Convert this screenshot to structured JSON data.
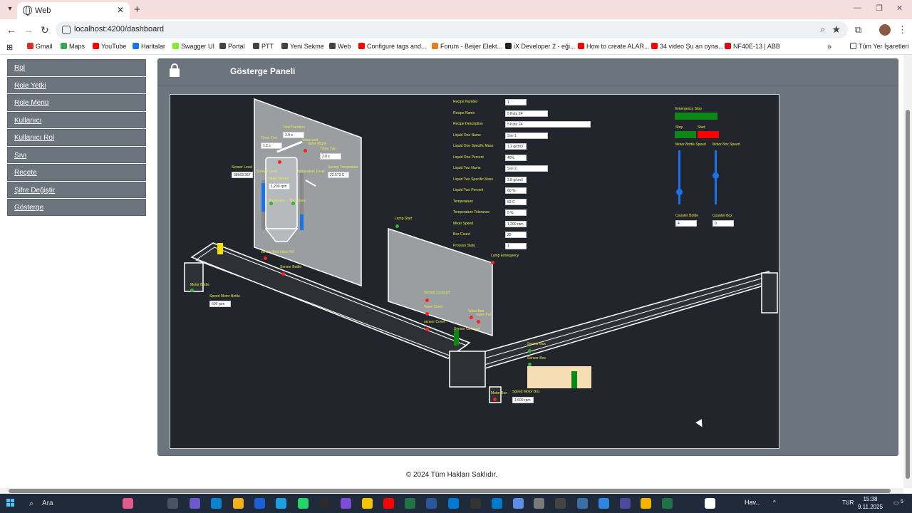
{
  "browser": {
    "tab_title": "Web",
    "url": "localhost:4200/dashboard",
    "bookmarks": [
      {
        "label": "Gmail",
        "color": "#d93025"
      },
      {
        "label": "Maps",
        "color": "#34a853"
      },
      {
        "label": "YouTube",
        "color": "#ff0000"
      },
      {
        "label": "Haritalar",
        "color": "#1a73e8"
      },
      {
        "label": "Swagger UI",
        "color": "#85ea2d"
      },
      {
        "label": "Portal",
        "color": "#444444"
      },
      {
        "label": "PTT",
        "color": "#444444"
      },
      {
        "label": "Yeni Sekme",
        "color": "#444444"
      },
      {
        "label": "Web",
        "color": "#444444"
      },
      {
        "label": "Configure tags and...",
        "color": "#ff0000"
      },
      {
        "label": "Forum - Beijer Elekt...",
        "color": "#e67e22"
      },
      {
        "label": "iX Developer 2 - eği...",
        "color": "#222222"
      },
      {
        "label": "How to create ALAR...",
        "color": "#ff0000"
      },
      {
        "label": "34 video Şu an oyna...",
        "color": "#ff0000"
      },
      {
        "label": "NF40E-13 | ABB",
        "color": "#e3051b"
      }
    ],
    "bookmarks_more": "Tüm Yer İşaretleri"
  },
  "sidebar": {
    "items": [
      {
        "label": "Rol"
      },
      {
        "label": "Role Yetki"
      },
      {
        "label": "Role Menü"
      },
      {
        "label": "Kullanıcı"
      },
      {
        "label": "Kullanıcı Rol"
      },
      {
        "label": "Sıvı"
      },
      {
        "label": "Reçete"
      },
      {
        "label": "Şifre Değiştir"
      },
      {
        "label": "Gösterge"
      }
    ]
  },
  "dashboard": {
    "title": "Gösterge Paneli",
    "recipe": [
      {
        "label": "Recipe Number",
        "value": "1"
      },
      {
        "label": "Recipe Name",
        "value": "5 Kutu 24"
      },
      {
        "label": "Recipe Description",
        "value": "5 Kutu 24"
      },
      {
        "label": "Liquid One Name",
        "value": "Sıvı 1"
      },
      {
        "label": "Liquid One Specific Mass",
        "value": "1.2 g/cm3"
      },
      {
        "label": "Liquid One Percent",
        "value": "40%"
      },
      {
        "label": "Liquid Two Name",
        "value": "Sıvı 2"
      },
      {
        "label": "Liquid Two Specific Mass",
        "value": "2.8 g/cm3"
      },
      {
        "label": "Liquid Two Percent",
        "value": "60 %"
      },
      {
        "label": "Temperature",
        "value": "52 C"
      },
      {
        "label": "Temperature Tolerance",
        "value": "5 %"
      },
      {
        "label": "Mixer Speed",
        "value": "1,200 rpm"
      },
      {
        "label": "Box Count",
        "value": "25"
      },
      {
        "label": "Process Statu",
        "value": "1"
      }
    ],
    "controls": {
      "emergency_stop": "Emergency Stop",
      "stop": "Stop",
      "start": "Start",
      "motor_bottle_speed": "Motor Bottle Speed",
      "motor_box_speed": "Motor Box Speed",
      "motor_bottle_speed_level": 0.2,
      "motor_box_speed_level": 0.55,
      "counter_bottle_label": "Counter Bottle",
      "counter_bottle_value": "4",
      "counter_box_label": "Counter Box",
      "counter_box_value": "0"
    },
    "tank": {
      "total_duration_label": "Total Duration",
      "total_duration": "3.9 s",
      "timer_one_label": "Timer One",
      "timer_one": "1.2 s",
      "timer_two_label": "Timer Two",
      "timer_two": "2.8 s",
      "valve_left": "Valve Left",
      "valve_right": "Valve Right",
      "sensor_level": "Sensor Level",
      "sensor_level_value": "38563.367",
      "sensor_level_inner": "Sensor Level",
      "mixer_speed_label": "Mixer Speed",
      "mixer_speed": "1,200 rpm",
      "temperature_level": "Temprature Level",
      "sensor_temperature_label": "Sensor Temprature",
      "sensor_temperature": "22.573 C",
      "resistance_left": "Resistans",
      "resistance_right": "Resistans",
      "sensor_bed_valve_fill": "sensor Bed Valve Fill",
      "sensor_bottle": "Sensor Bottle"
    },
    "conveyor": {
      "motor_bottle": "Motor Bottle",
      "speed_motor_bottle_label": "Speed Motor Bottle",
      "speed_motor_bottle": "609 rpm",
      "lamp_start": "Lamp Start",
      "lamp_emergency": "Lamp Emergency",
      "sensor_covered": "Sensor Covered",
      "valve_cover": "Valve Cover",
      "sensor_cover": "sensor Cover",
      "valve_box": "Valve Box",
      "valve_put": "Valve Put",
      "sensor_covered_2": "Sensor Covered",
      "sensor_box_1": "Sensor Box",
      "sensor_box_2": "Sensor Box",
      "motor_box": "Motor Box",
      "speed_motor_box_label": "Speed Motor Box",
      "speed_motor_box": "1,600 rpm"
    }
  },
  "footer": "© 2024 Tüm Hakları Saklıdır.",
  "taskbar": {
    "search": "Ara",
    "weather": "Hav...",
    "lang": "TUR",
    "time": "15:38",
    "date": "9.11.2025",
    "notifications": "5"
  }
}
